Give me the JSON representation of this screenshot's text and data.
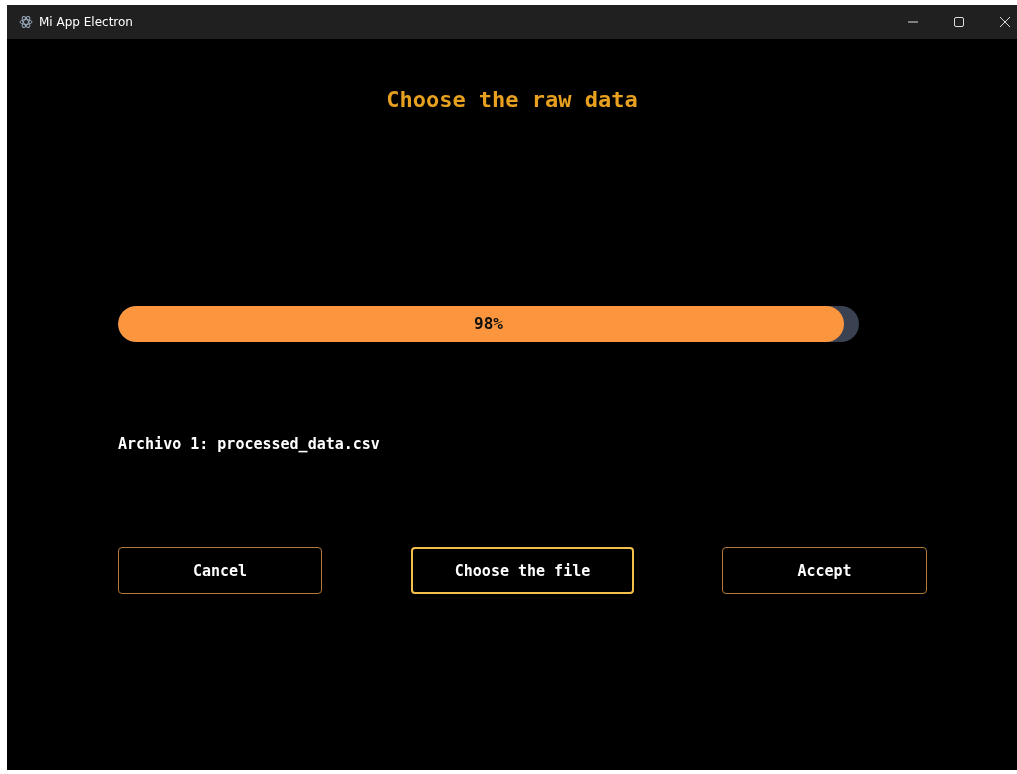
{
  "window": {
    "title": "Mi App Electron"
  },
  "heading": "Choose the raw data",
  "progress": {
    "level": 0.98,
    "label": "98%"
  },
  "file_line": "Archivo 1: processed_data.csv",
  "buttons": [
    {
      "label": "Cancel",
      "selected": false
    },
    {
      "label": "Choose the file",
      "selected": true
    },
    {
      "label": "Accept",
      "selected": false
    }
  ]
}
